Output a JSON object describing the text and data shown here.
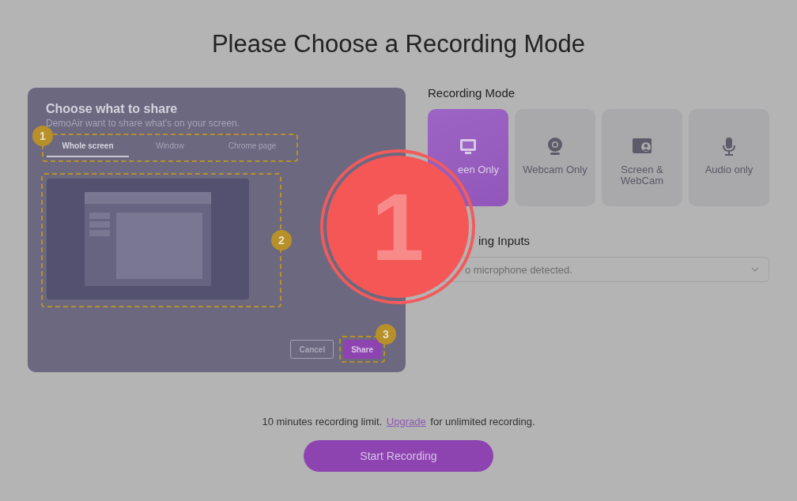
{
  "title": "Please Choose a Recording Mode",
  "share_dialog": {
    "title": "Choose what to share",
    "subtitle": "DemoAir want to share what's on your screen.",
    "tabs": [
      {
        "label": "Whole screen",
        "selected": true
      },
      {
        "label": "Window",
        "selected": false
      },
      {
        "label": "Chrome page",
        "selected": false
      }
    ],
    "buttons": [
      {
        "label": "Cancel",
        "kind": "secondary"
      },
      {
        "label": "Share",
        "kind": "primary"
      }
    ],
    "callouts": [
      "1",
      "2",
      "3"
    ]
  },
  "recording_mode": {
    "heading": "Recording Mode",
    "modes": [
      {
        "label": "een Only",
        "kind": "screen",
        "selected": true
      },
      {
        "label": "Webcam Only",
        "kind": "webcam",
        "selected": false
      },
      {
        "label": "Screen & WebCam",
        "kind": "screen-webcam",
        "selected": false
      },
      {
        "label": "Audio only",
        "kind": "audio",
        "selected": false
      }
    ]
  },
  "inputs": {
    "heading": "ing Inputs",
    "placeholder": "o microphone detected."
  },
  "step_marker": "1",
  "limit_note": {
    "before": "10 minutes recording limit. ",
    "link": "Upgrade",
    "after": " for unlimited recording."
  },
  "start_button": "Start Recording"
}
